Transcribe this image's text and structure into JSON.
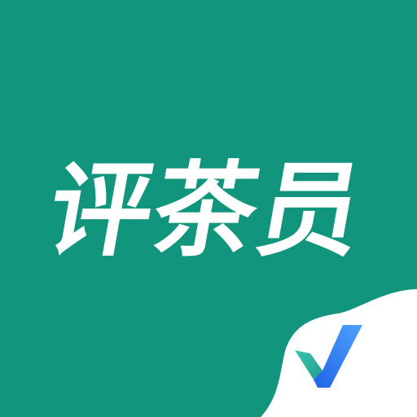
{
  "app_icon": {
    "title": "评茶员",
    "colors": {
      "background": "#12957D",
      "corner": "#FFFFFF",
      "text": "#FFFFFF",
      "check_left": "#2BB5A0",
      "check_right_light": "#4FA2FF",
      "check_right_dark": "#1E63E6"
    },
    "badge_icon": "checkmark-icon"
  }
}
